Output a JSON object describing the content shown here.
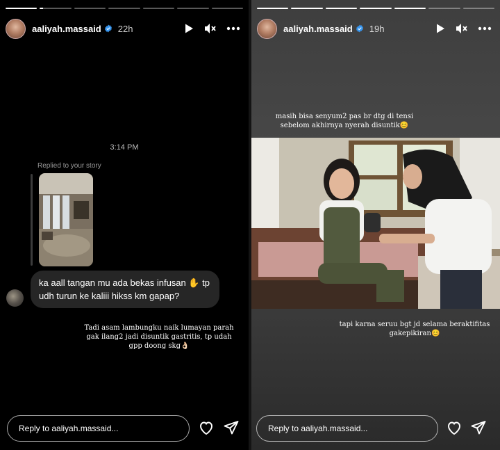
{
  "left_story": {
    "progress": [
      1,
      0.1,
      0,
      0,
      0,
      0,
      0
    ],
    "username": "aaliyah.massaid",
    "time": "22h",
    "chat_time": "3:14 PM",
    "replied_label": "Replied to your story",
    "message": "ka aall tangan mu ada bekas infusan ✋ tp udh turun ke kaliii hikss km gapap?",
    "caption": "Tadi asam lambungku naik lumayan parah gak ilang2 jadi disuntik gastritis, tp udah gpp doong skg👌🏻",
    "reply_placeholder": "Reply to aaliyah.massaid..."
  },
  "right_story": {
    "progress": [
      1,
      1,
      1,
      1,
      1,
      0,
      0
    ],
    "username": "aaliyah.massaid",
    "time": "19h",
    "caption_top": "masih bisa senyum2 pas br dtg di tensi sebelom akhirnya nyerah disuntik😊",
    "caption_bottom": "tapi karna seruu bgt jd selama beraktifitas gakepikiran😊",
    "reply_placeholder": "Reply to aaliyah.massaid..."
  },
  "icons": [
    "verified-badge-icon",
    "play-icon",
    "mute-icon",
    "more-icon",
    "heart-icon",
    "send-icon"
  ],
  "colors": {
    "background": "#000000",
    "bubble": "#262626",
    "verified": "#3897f0"
  }
}
